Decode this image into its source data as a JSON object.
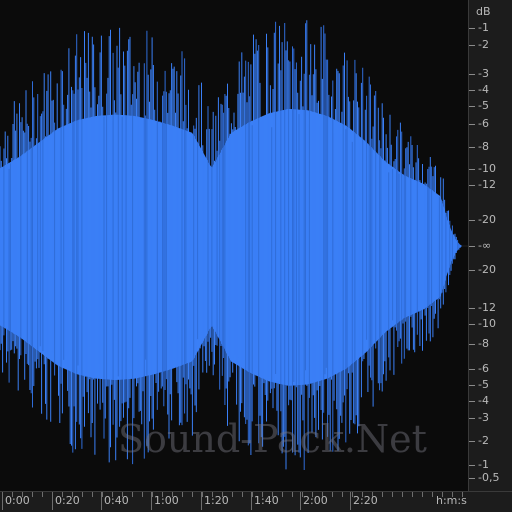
{
  "colors": {
    "waveform": "#3a7ff6",
    "waveform_edge": "#2f6cd8",
    "background": "#0b0b0b",
    "ruler": "#1c1c1c"
  },
  "db_ruler": {
    "unit_label": "dB",
    "labels": [
      "-1",
      "-2",
      "-3",
      "-4",
      "-5",
      "-6",
      "-8",
      "-10",
      "-12",
      "-20",
      "-∞",
      "-20",
      "-12",
      "-10",
      "-8",
      "-6",
      "-5",
      "-4",
      "-3",
      "-2",
      "-1",
      "-0,5"
    ]
  },
  "time_ruler": {
    "labels": [
      "0:00",
      "0:20",
      "0:40",
      "1:00",
      "1:20",
      "1:40",
      "2:00",
      "2:20"
    ],
    "unit_label": "h:m:s"
  },
  "watermark": "Sound-Pack.Net",
  "waveform_envelope": [
    0.55,
    0.63,
    0.73,
    0.83,
    0.89,
    0.92,
    0.93,
    0.92,
    0.89,
    0.85,
    0.8,
    0.55,
    0.8,
    0.88,
    0.94,
    0.97,
    0.96,
    0.92,
    0.85,
    0.74,
    0.6,
    0.5,
    0.44,
    0.34,
    0.0
  ]
}
